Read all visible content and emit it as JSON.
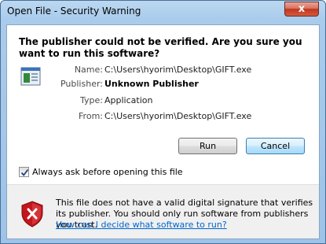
{
  "window": {
    "title": "Open File - Security Warning",
    "close_label": "x"
  },
  "heading": "The publisher could not be verified.  Are you sure you want to run this software?",
  "details": {
    "name_label": "Name:",
    "name_value": "C:\\Users\\hyorim\\Desktop\\GIFT.exe",
    "publisher_label": "Publisher:",
    "publisher_value": "Unknown Publisher",
    "type_label": "Type:",
    "type_value": "Application",
    "from_label": "From:",
    "from_value": "C:\\Users\\hyorim\\Desktop\\GIFT.exe"
  },
  "buttons": {
    "run": "Run",
    "cancel": "Cancel"
  },
  "checkbox": {
    "label": "Always ask before opening this file",
    "checked": true
  },
  "warning": {
    "text": "This file does not have a valid digital signature that verifies its publisher.  You should only run software from publishers you trust.",
    "link": "How can I decide what software to run?"
  },
  "colors": {
    "link": "#0066cc",
    "shield_red": "#c4161c",
    "titlebar": "#a9cbec"
  },
  "icons": {
    "app": "application-icon",
    "shield": "shield-x-icon",
    "close": "close-icon",
    "check": "checkmark-icon"
  }
}
